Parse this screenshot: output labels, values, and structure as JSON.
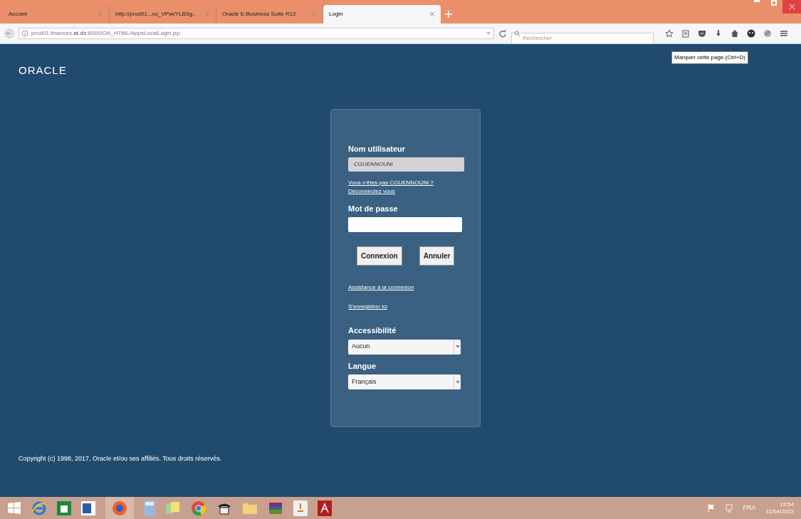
{
  "browser": {
    "tabs": [
      {
        "label": "Accueil",
        "selected": false
      },
      {
        "label": "http://prod01...xo_VPwrYLBSg..",
        "selected": false
      },
      {
        "label": "Oracle E-Business Suite R12",
        "selected": false
      },
      {
        "label": "Login",
        "selected": true
      }
    ],
    "url": "prod01.finances.**at.dz**:8000/OA_HTML/AppsLocalLogin.jsp",
    "search": {
      "placeholder": "Rechercher"
    },
    "tooltip": "Marquer cette page (Ctrl+D)"
  },
  "page": {
    "logo": "ORACLE",
    "login": {
      "username_label": "Nom utilisateur",
      "username_value": "CGUENNOUNI",
      "not_you_link": "Vous n'êtes pas CGUENNOUNI ?",
      "logout_link": "Déconnectez vous",
      "password_label": "Mot de passe",
      "buttons": [
        "Connexion",
        "Annuler"
      ],
      "help_link": "Assistance à la connexion",
      "register_link": "S'enregistrer ici",
      "accessibility_label": "Accessibilité",
      "accessibility_value": "Aucun",
      "language_label": "Langue",
      "language_value": "Français"
    },
    "copyright": "Copyright (c) 1998, 2017, Oracle et/ou ses affiliés. Tous droits réservés."
  },
  "taskbar": {
    "language": "FRA",
    "time": "12:54",
    "date": "11/04/2022"
  }
}
